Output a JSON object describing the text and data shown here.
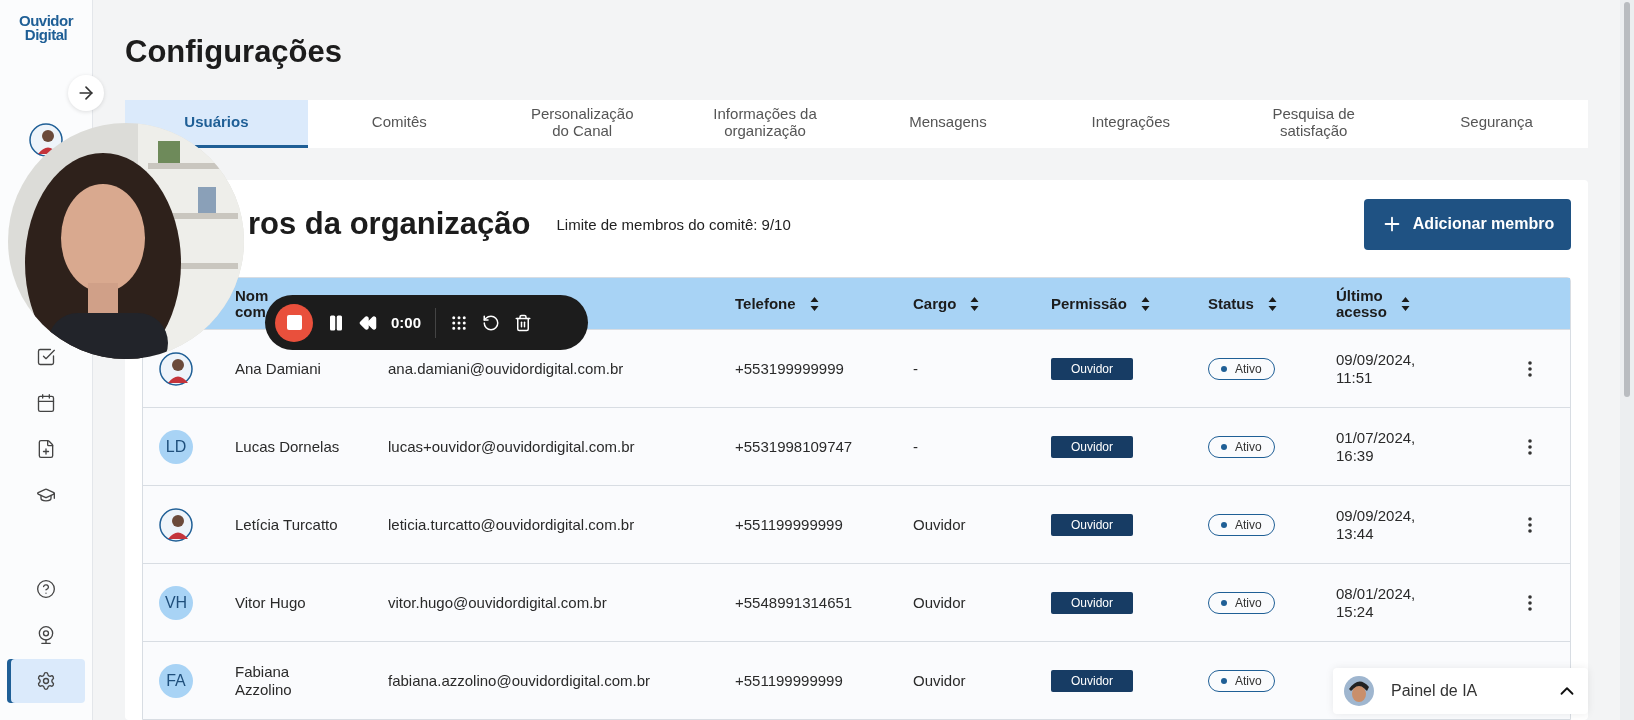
{
  "sidebar": {
    "logo": {
      "line1": "Ouvidor",
      "line2": "Digital"
    },
    "items": [
      {
        "kind": "check",
        "selected": false
      },
      {
        "kind": "calendar",
        "selected": false
      },
      {
        "kind": "file-plus",
        "selected": false
      },
      {
        "kind": "graduation",
        "selected": false
      },
      {
        "kind": "help",
        "selected": false
      },
      {
        "kind": "webcam",
        "selected": false
      },
      {
        "kind": "settings",
        "selected": true
      }
    ]
  },
  "page": {
    "title": "Configurações"
  },
  "tabs": [
    {
      "label": "Usuários",
      "selected": true
    },
    {
      "label": "Comitês",
      "selected": false
    },
    {
      "label": "Personalização do Canal",
      "selected": false
    },
    {
      "label": "Informações da organização",
      "selected": false
    },
    {
      "label": "Mensagens",
      "selected": false
    },
    {
      "label": "Integrações",
      "selected": false
    },
    {
      "label": "Pesquisa de satisfação",
      "selected": false
    },
    {
      "label": "Segurança",
      "selected": false
    }
  ],
  "members": {
    "heading": "ros da organização",
    "limit": "Limite de membros do comitê: 9/10",
    "add_button": "Adicionar membro",
    "columns": [
      {
        "label": "Nom\ncom"
      },
      {
        "label": "Telefone"
      },
      {
        "label": "Cargo"
      },
      {
        "label": "Permissão"
      },
      {
        "label": "Status"
      },
      {
        "label": "Último\nacesso"
      }
    ],
    "rows": [
      {
        "name": "Ana Damiani",
        "email": "ana.damiani@ouvidordigital.com.br",
        "phone": "+553199999999",
        "role": "-",
        "permission": "Ouvidor",
        "status": "Ativo",
        "last_access": "09/09/2024,\n11:51"
      },
      {
        "avatar": {
          "kind": "initials",
          "text": "LD"
        },
        "name": "Lucas Dornelas",
        "email": "lucas+ouvidor@ouvidordigital.com.br",
        "phone": "+5531998109747",
        "role": "-",
        "permission": "Ouvidor",
        "status": "Ativo",
        "last_access": "01/07/2024,\n16:39"
      },
      {
        "name": "Letícia Turcatto",
        "email": "leticia.turcatto@ouvidordigital.com.br",
        "phone": "+551199999999",
        "role": "Ouvidor",
        "permission": "Ouvidor",
        "status": "Ativo",
        "last_access": "09/09/2024,\n13:44"
      },
      {
        "avatar": {
          "kind": "initials",
          "text": "VH"
        },
        "name": "Vitor Hugo",
        "email": "vitor.hugo@ouvidordigital.com.br",
        "phone": "+5548991314651",
        "role": "Ouvidor",
        "permission": "Ouvidor",
        "status": "Ativo",
        "last_access": "08/01/2024,\n15:24"
      },
      {
        "avatar": {
          "kind": "initials",
          "text": "FA"
        },
        "name": "Fabiana\nAzzolino",
        "email": "fabiana.azzolino@ouvidordigital.com.br",
        "phone": "+551199999999",
        "role": "Ouvidor",
        "permission": "Ouvidor",
        "status": "Ativo"
      }
    ]
  },
  "recorder": {
    "time": "0:00"
  },
  "ai_panel": {
    "label": "Painel de IA"
  }
}
